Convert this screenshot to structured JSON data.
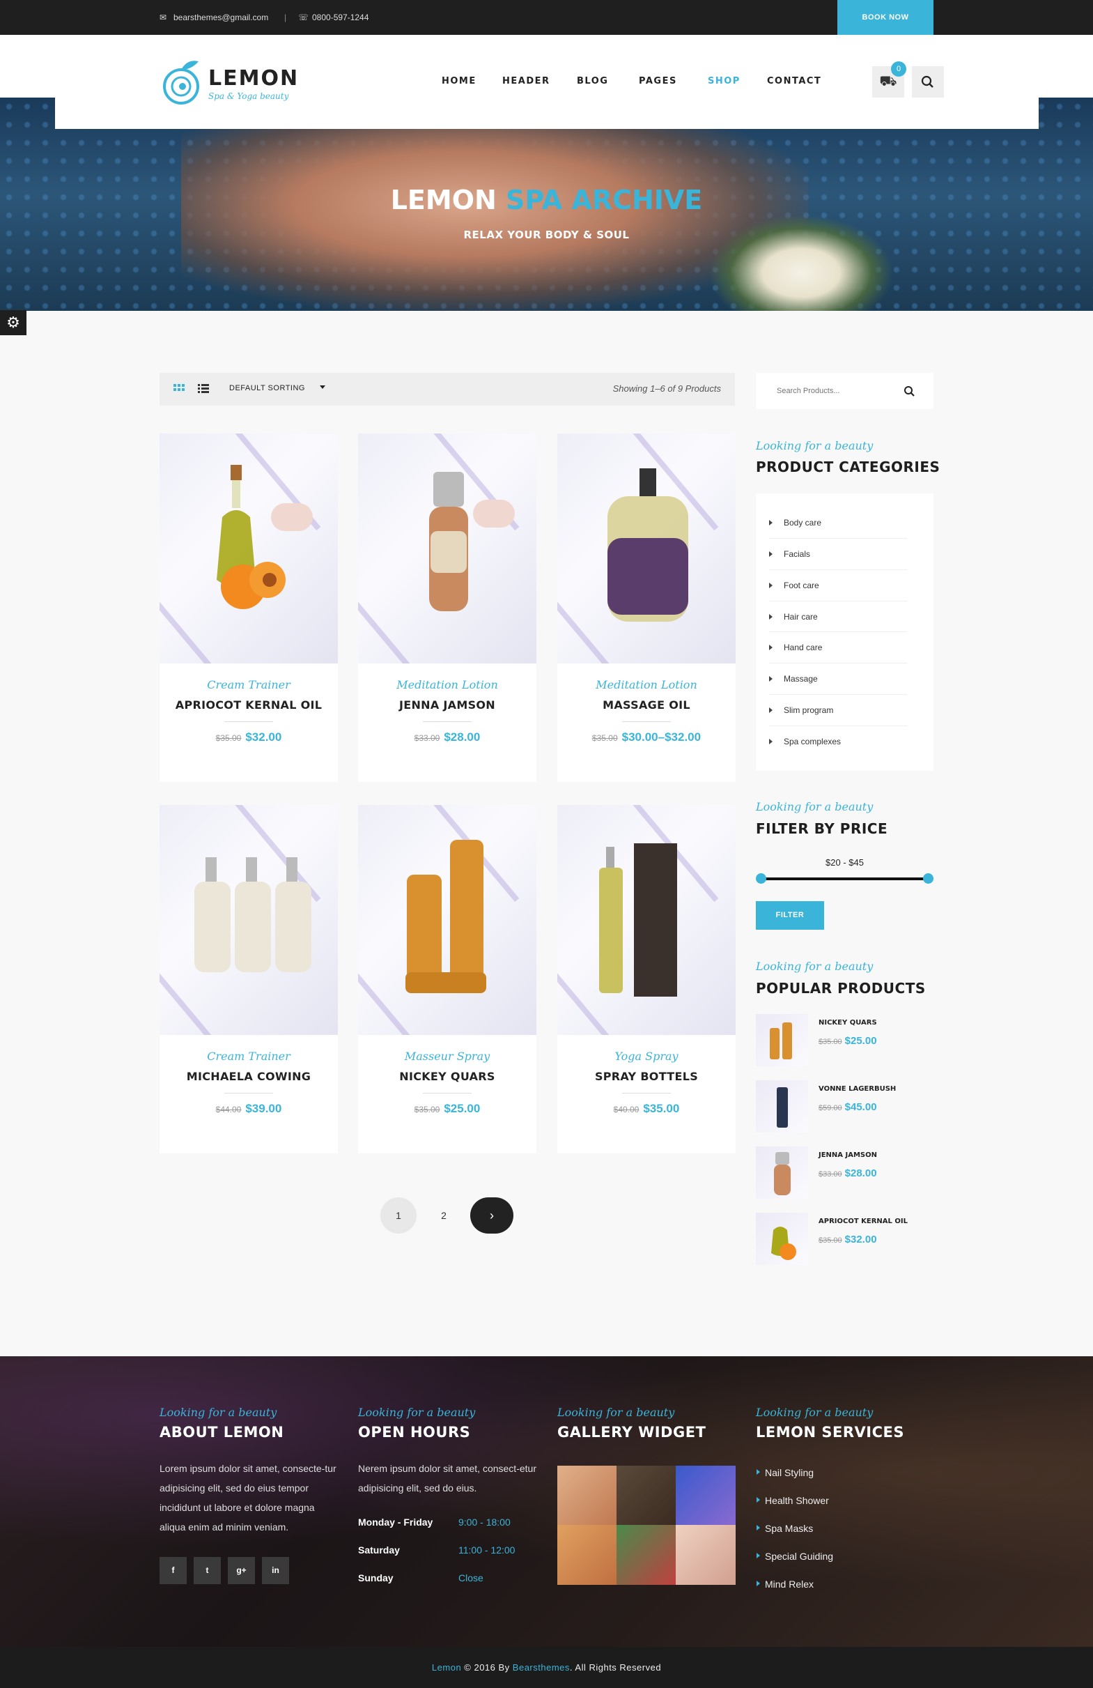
{
  "topbar": {
    "email": "bearsthemes@gmail.com",
    "phone": "0800-597-1244",
    "book_now": "BOOK NOW"
  },
  "brand": {
    "name": "LEMON",
    "tagline": "Spa & Yoga beauty"
  },
  "nav": [
    "HOME",
    "HEADER",
    "BLOG",
    "PAGES",
    "SHOP",
    "CONTACT"
  ],
  "active_nav": "SHOP",
  "cart": {
    "count": "0"
  },
  "hero": {
    "title_a": "LEMON",
    "title_b": "SPA ARCHIVE",
    "subtitle": "RELAX YOUR BODY & SOUL"
  },
  "toolbar": {
    "sorting": "DEFAULT SORTING",
    "showing": "Showing 1–6 of 9 Products"
  },
  "products": [
    {
      "category": "Cream Trainer",
      "name": "APRIOCOT KERNAL OIL",
      "old_price": "$35.00",
      "price": "$32.00"
    },
    {
      "category": "Meditation Lotion",
      "name": "JENNA JAMSON",
      "old_price": "$33.00",
      "price": "$28.00"
    },
    {
      "category": "Meditation Lotion",
      "name": "MASSAGE OIL",
      "old_price": "$35.00",
      "price": "$30.00–$32.00"
    },
    {
      "category": "Cream Trainer",
      "name": "MICHAELA COWING",
      "old_price": "$44.00",
      "price": "$39.00"
    },
    {
      "category": "Masseur Spray",
      "name": "NICKEY QUARS",
      "old_price": "$35.00",
      "price": "$25.00"
    },
    {
      "category": "Yoga Spray",
      "name": "SPRAY BOTTELS",
      "old_price": "$40.00",
      "price": "$35.00"
    }
  ],
  "pagination": [
    "1",
    "2",
    "›"
  ],
  "sidebar": {
    "search_placeholder": "Search Products...",
    "eyebrow": "Looking for a beauty",
    "categories_title": "PRODUCT CATEGORIES",
    "categories": [
      "Body care",
      "Facials",
      "Foot care",
      "Hair care",
      "Hand care",
      "Massage",
      "Slim program",
      "Spa complexes"
    ],
    "filter_title": "FILTER BY PRICE",
    "price_range": "$20 - $45",
    "filter_button": "FILTER",
    "popular_title": "POPULAR PRODUCTS",
    "popular": [
      {
        "name": "NICKEY QUARS",
        "old_price": "$35.00",
        "price": "$25.00"
      },
      {
        "name": "VONNE LAGERBUSH",
        "old_price": "$59.00",
        "price": "$45.00"
      },
      {
        "name": "JENNA JAMSON",
        "old_price": "$33.00",
        "price": "$28.00"
      },
      {
        "name": "APRIOCOT KERNAL OIL",
        "old_price": "$35.00",
        "price": "$32.00"
      }
    ]
  },
  "footer": {
    "eyebrow": "Looking for a beauty",
    "about_title": "ABOUT LEMON",
    "about_text": "Lorem ipsum dolor sit amet, consecte-tur adipisicing elit, sed do eius tempor incididunt ut labore et dolore magna aliqua enim ad minim veniam.",
    "hours_title": "OPEN HOURS",
    "hours_text": "Nerem ipsum dolor sit amet, consect-etur adipisicing elit, sed do eius.",
    "hours": [
      {
        "day": "Monday - Friday",
        "time": "9:00 - 18:00"
      },
      {
        "day": "Saturday",
        "time": "11:00 - 12:00"
      },
      {
        "day": "Sunday",
        "time": "Close"
      }
    ],
    "gallery_title": "GALLERY WIDGET",
    "services_title": "LEMON SERVICES",
    "services": [
      "Nail Styling",
      "Health Shower",
      "Spa Masks",
      "Special Guiding",
      "Mind Relex"
    ],
    "social": [
      "f",
      "t",
      "g+",
      "in"
    ]
  },
  "copyright": {
    "brand": "Lemon",
    "middle": " © 2016 By ",
    "author": "Bearsthemes",
    "end": ". All Rights Reserved"
  },
  "colors": {
    "accent": "#3ab4d9",
    "dark": "#1f1f1f"
  }
}
